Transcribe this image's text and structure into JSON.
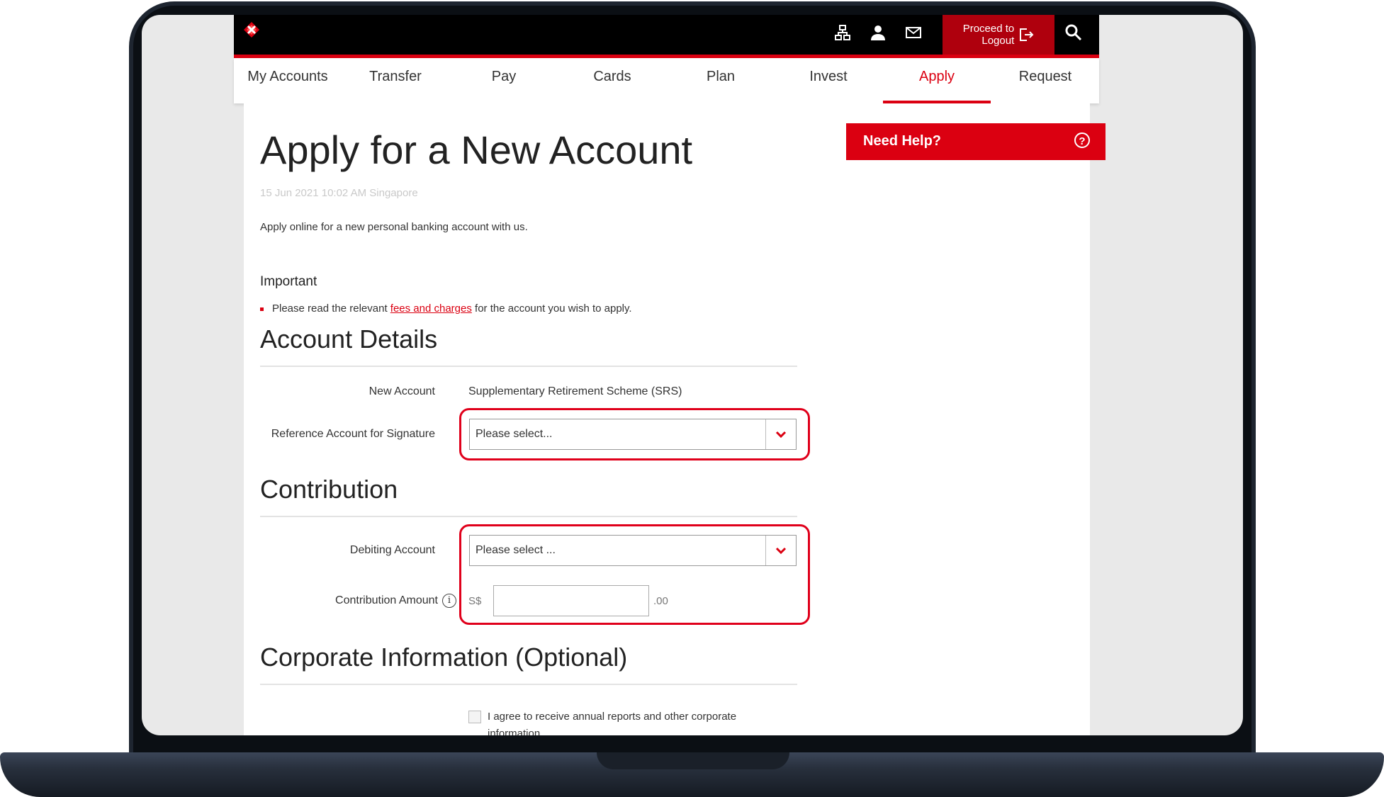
{
  "header": {
    "logout_line1": "Proceed to",
    "logout_line2": "Logout"
  },
  "nav": {
    "items": [
      {
        "label": "My Accounts"
      },
      {
        "label": "Transfer"
      },
      {
        "label": "Pay"
      },
      {
        "label": "Cards"
      },
      {
        "label": "Plan"
      },
      {
        "label": "Invest"
      },
      {
        "label": "Apply"
      },
      {
        "label": "Request"
      }
    ],
    "active": "Apply"
  },
  "page": {
    "title": "Apply for a New Account",
    "timestamp": "15 Jun 2021 10:02 AM Singapore",
    "intro": "Apply online for a new personal banking account with us.",
    "important_heading": "Important",
    "important_prefix": "Please read the relevant",
    "important_link": "fees and charges",
    "important_suffix": "for the account you wish to apply."
  },
  "help": {
    "label": "Need Help?",
    "icon": "?"
  },
  "account_details": {
    "section_title": "Account Details",
    "new_account_label": "New Account",
    "new_account_value": "Supplementary Retirement Scheme (SRS)",
    "reference_label": "Reference Account for Signature",
    "reference_value": "Please select..."
  },
  "contribution": {
    "section_title": "Contribution",
    "debiting_label": "Debiting Account",
    "debiting_value": "Please select ...",
    "amount_label": "Contribution Amount",
    "amount_info_icon": "i",
    "currency_prefix": "S$",
    "amount_value": "",
    "cents_suffix": ".00"
  },
  "corporate": {
    "section_title": "Corporate Information (Optional)",
    "agree_label": "I agree to receive annual reports and other corporate information.",
    "agree_checked": false
  },
  "colors": {
    "brand_red": "#db0011",
    "highlight_red": "#e0001b",
    "top_bar": "#000000"
  },
  "icons": [
    "logo-icon",
    "sitemap-icon",
    "profile-icon",
    "mail-icon",
    "logout-icon",
    "search-icon",
    "chevron-down-icon",
    "help-circle-icon",
    "info-icon"
  ]
}
